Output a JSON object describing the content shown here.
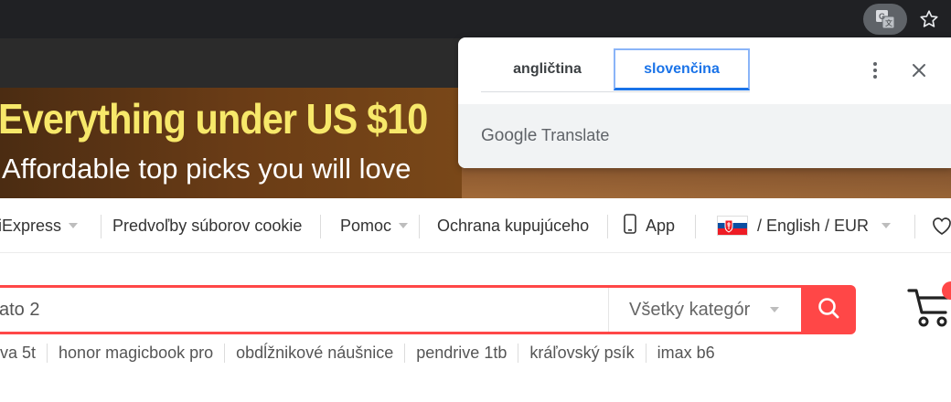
{
  "browser": {
    "translate_icon": "google-translate-icon",
    "bookmark_icon": "star-icon"
  },
  "banner": {
    "headline": "Everything under US $10",
    "subline": "Affordable top picks you will love"
  },
  "nav": {
    "items": [
      {
        "label": "iExpress",
        "dropdown": true
      },
      {
        "label": "Predvoľby súborov cookie",
        "dropdown": false
      },
      {
        "label": "Pomoc",
        "dropdown": true
      },
      {
        "label": "Ochrana kupujúceho",
        "dropdown": false
      },
      {
        "label": "App",
        "icon": "phone-icon"
      },
      {
        "label": "/ English /  EUR",
        "dropdown": true,
        "icon": "slovakia-flag-icon"
      }
    ],
    "wishlist_icon": "heart-icon"
  },
  "search": {
    "query": "ato 2",
    "category": "Všetky kategór",
    "button_icon": "search-icon",
    "accent": "#ff4747"
  },
  "suggestions": [
    "va 5t",
    "honor magicbook pro",
    "obdĺžnikové náušnice",
    "pendrive 1tb",
    "kráľovský psík",
    "imax b6"
  ],
  "cart": {
    "icon": "cart-icon"
  },
  "translate_popup": {
    "tabs": [
      "angličtina",
      "slovenčina"
    ],
    "active_tab": "slovenčina",
    "brand": "Google",
    "product": "Translate",
    "more_icon": "more-vert-icon",
    "close_icon": "close-icon"
  }
}
